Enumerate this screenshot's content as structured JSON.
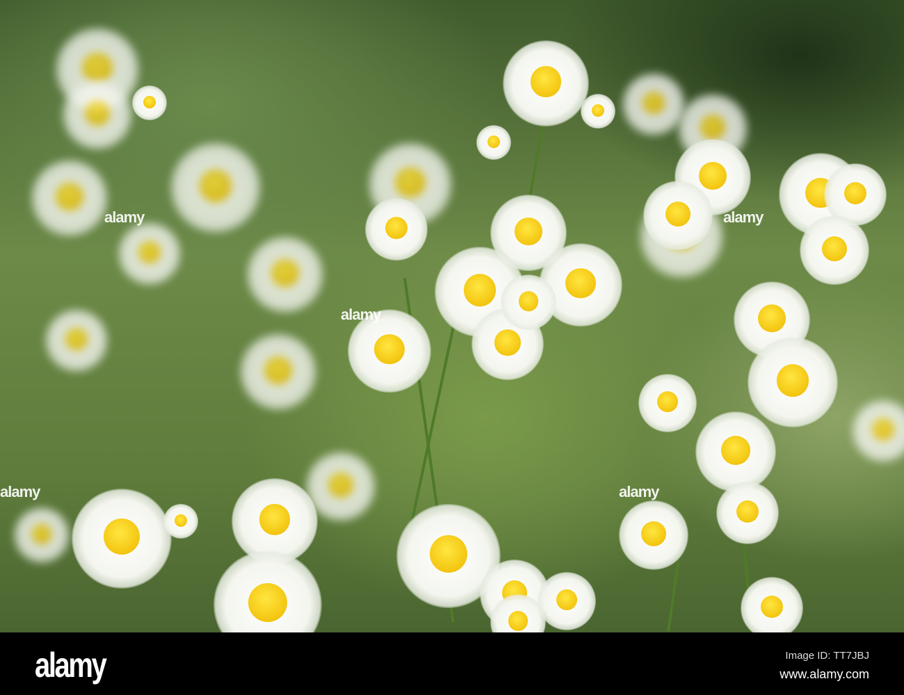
{
  "photo": {
    "subject": "chamomile flowers",
    "watermark": "alamy"
  },
  "footer": {
    "logo": "alamy",
    "image_id": "Image ID: TT7JBJ",
    "website": "www.alamy.com"
  }
}
